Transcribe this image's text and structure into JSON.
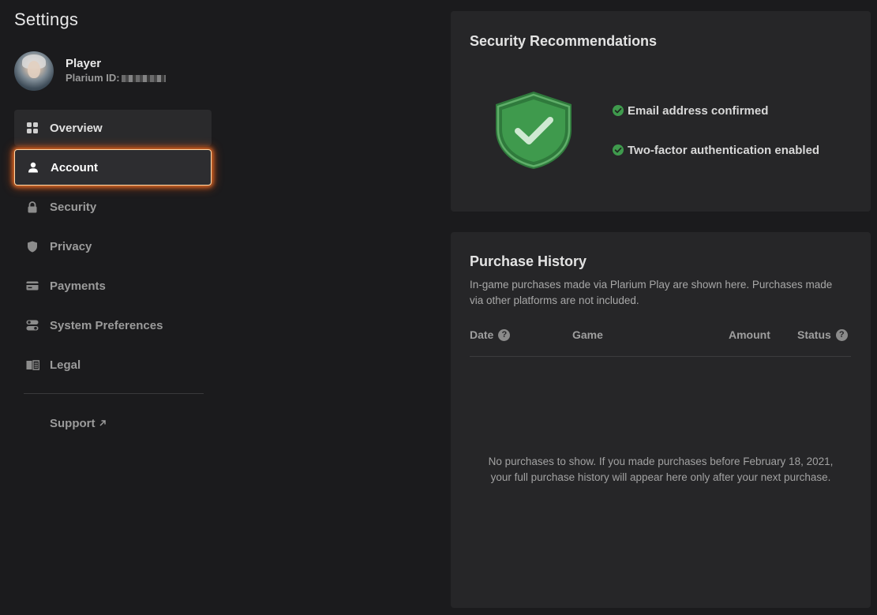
{
  "sidebar": {
    "title": "Settings",
    "profile": {
      "name": "Player",
      "id_label": "Plarium ID:"
    },
    "items": [
      {
        "label": "Overview",
        "icon": "grid-icon"
      },
      {
        "label": "Account",
        "icon": "user-icon"
      },
      {
        "label": "Security",
        "icon": "lock-icon"
      },
      {
        "label": "Privacy",
        "icon": "shield-icon"
      },
      {
        "label": "Payments",
        "icon": "credit-card-icon"
      },
      {
        "label": "System Preferences",
        "icon": "toggles-icon"
      },
      {
        "label": "Legal",
        "icon": "book-icon"
      }
    ],
    "support": {
      "label": "Support",
      "icon": "external-link-icon"
    }
  },
  "security": {
    "title": "Security Recommendations",
    "checks": [
      "Email address confirmed",
      "Two-factor authentication enabled"
    ]
  },
  "purchase": {
    "title": "Purchase History",
    "description": "In-game purchases made via Plarium Play are shown here. Purchases made via other platforms are not included.",
    "columns": {
      "date": "Date",
      "game": "Game",
      "amount": "Amount",
      "status": "Status"
    },
    "empty": "No purchases to show. If you made purchases before February 18, 2021, your full purchase history will appear here only after your next purchase."
  },
  "colors": {
    "background": "#1b1b1d",
    "card": "#262628",
    "accent_glow": "#ff7a28",
    "success": "#3f9a4d"
  }
}
